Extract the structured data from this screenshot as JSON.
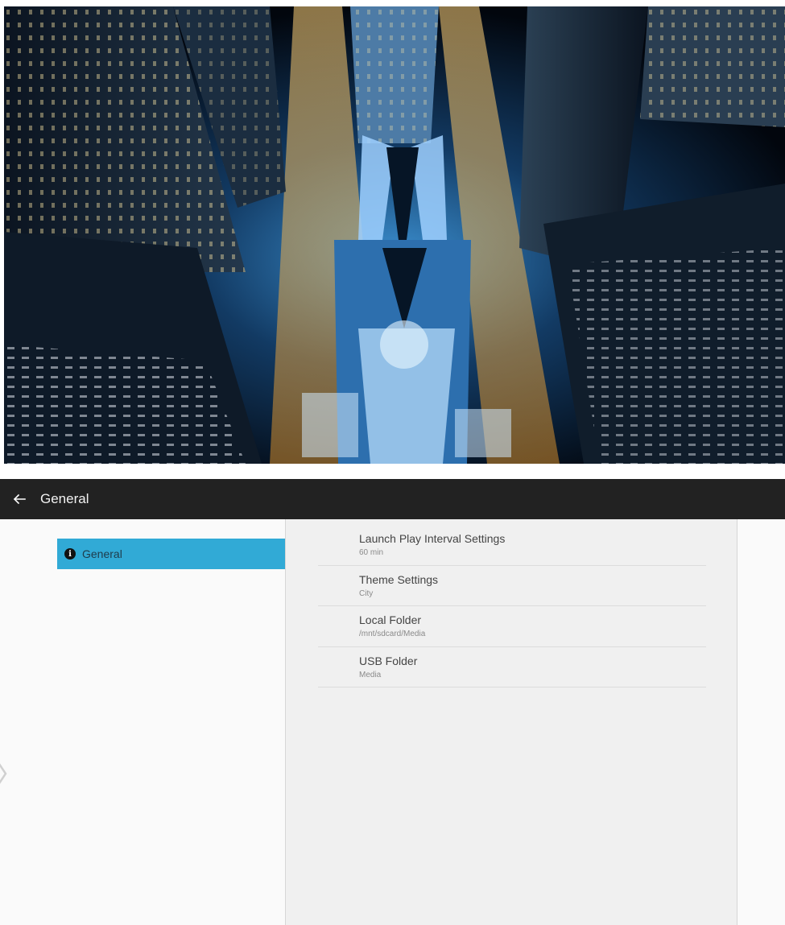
{
  "preview": {
    "description_icon": "city-wallpaper-image"
  },
  "appbar": {
    "title": "General",
    "back_icon": "arrow-left-icon"
  },
  "sidebar": {
    "items": [
      {
        "label": "General",
        "icon": "info-icon",
        "selected": true
      }
    ]
  },
  "settings": {
    "rows": [
      {
        "title": "Launch Play Interval Settings",
        "value": "60 min"
      },
      {
        "title": "Theme Settings",
        "value": "City"
      },
      {
        "title": "Local Folder",
        "value": "/mnt/sdcard/Media"
      },
      {
        "title": "USB Folder",
        "value": "Media"
      }
    ]
  },
  "colors": {
    "accent": "#31aad6",
    "appbar": "#222222",
    "panel": "#f0f0f0"
  }
}
